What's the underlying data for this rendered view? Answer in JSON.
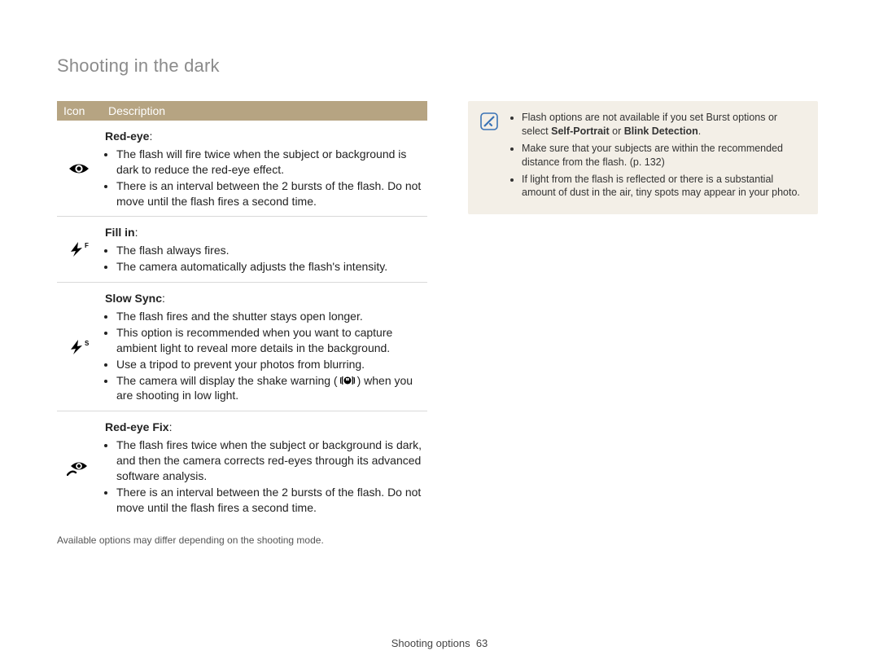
{
  "title": "Shooting in the dark",
  "table": {
    "header_icon": "Icon",
    "header_desc": "Description",
    "rows": [
      {
        "name": "Red-eye",
        "colon": ":",
        "bullets": [
          "The flash will fire twice when the subject or background is dark to reduce the red-eye effect.",
          "There is an interval between the 2 bursts of the flash. Do not move until the flash fires a second time."
        ]
      },
      {
        "name": "Fill in",
        "colon": ":",
        "bullets": [
          "The flash always fires.",
          "The camera automatically adjusts the flash's intensity."
        ]
      },
      {
        "name": "Slow Sync",
        "colon": ":",
        "bullets": [
          "The flash fires and the shutter stays open longer.",
          "This option is recommended when you want to capture ambient light to reveal more details in the background.",
          "Use a tripod to prevent your photos from blurring.",
          "The camera will display the shake warning (__SHAKE__) when you are shooting in low light."
        ]
      },
      {
        "name": "Red-eye Fix",
        "colon": ":",
        "bullets": [
          "The flash fires twice when the subject or background is dark, and then the camera corrects red-eyes through its advanced software analysis.",
          "There is an interval between the 2 bursts of the flash. Do not move until the flash fires a second time."
        ]
      }
    ],
    "footnote": "Available options may differ depending on the shooting mode."
  },
  "note": {
    "items": [
      {
        "pre": "Flash options are not available if you set Burst options or select ",
        "bold": "Self-Portrait",
        "mid": " or ",
        "bold2": "Blink Detection",
        "post": "."
      },
      {
        "text": "Make sure that your subjects are within the recommended distance from the flash. (p. 132)"
      },
      {
        "text": "If light from the flash is reflected or there is a substantial amount of dust in the air, tiny spots may appear in your photo."
      }
    ]
  },
  "footer": {
    "section": "Shooting options",
    "page": "63"
  }
}
